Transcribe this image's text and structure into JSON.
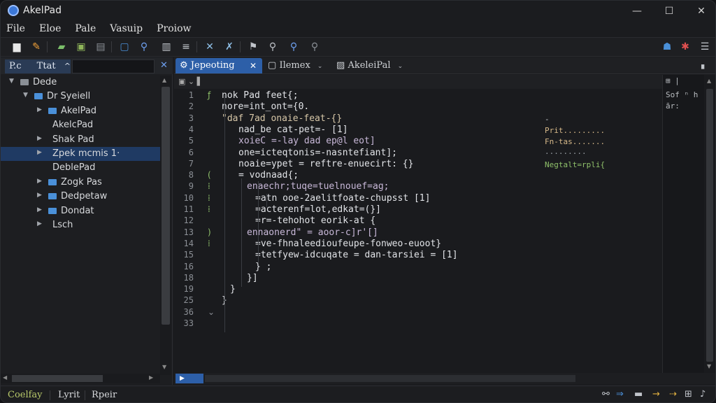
{
  "window": {
    "title": "AkelPad",
    "minimize": "—",
    "maximize": "☐",
    "close": "✕"
  },
  "menu": [
    "File",
    "Eloe",
    "Pale",
    "Vasuip",
    "Proiow"
  ],
  "toolbar": {
    "icons": [
      {
        "name": "new-file-icon",
        "glyph": "▆",
        "color": "#e8e8e8"
      },
      {
        "name": "edit-icon",
        "glyph": "✎",
        "color": "#f2a23a"
      },
      {
        "name": "open-icon",
        "glyph": "▰",
        "color": "#7bbf6a"
      },
      {
        "name": "save-icon",
        "glyph": "▣",
        "color": "#8fb55a"
      },
      {
        "name": "save-all-icon",
        "glyph": "▤",
        "color": "#8a8f96"
      },
      {
        "name": "view-icon",
        "glyph": "▢",
        "color": "#4a90d9"
      },
      {
        "name": "search-icon",
        "glyph": "⚲",
        "color": "#6ea0f0"
      },
      {
        "name": "panel-icon",
        "glyph": "▥",
        "color": "#c0c4ca"
      },
      {
        "name": "lines-icon",
        "glyph": "≡",
        "color": "#c0c4ca"
      },
      {
        "name": "tools-icon",
        "glyph": "✕",
        "color": "#8fc0e8"
      },
      {
        "name": "pin-icon",
        "glyph": "✗",
        "color": "#8fc0e8"
      },
      {
        "name": "flag-icon",
        "glyph": "⚑",
        "color": "#c0c4ca"
      },
      {
        "name": "zoom-icon",
        "glyph": "⚲",
        "color": "#c0c4ca"
      },
      {
        "name": "zoom-in-icon",
        "glyph": "⚲",
        "color": "#6ea0f0"
      },
      {
        "name": "zoom-out-icon",
        "glyph": "⚲",
        "color": "#8a8f96"
      }
    ],
    "right_icons": [
      {
        "name": "user-icon",
        "glyph": "☗",
        "color": "#4a90d9"
      },
      {
        "name": "gear-icon",
        "glyph": "✱",
        "color": "#e05050"
      },
      {
        "name": "list-icon",
        "glyph": "☰",
        "color": "#c0c4ca"
      }
    ]
  },
  "sidebar": {
    "tab_label": "P.c",
    "tab_text": "Ttat",
    "tab_chevron": "^",
    "close": "✕",
    "tree": [
      {
        "label": "Dede",
        "level": 0,
        "arrow": "▼",
        "folder": "gray"
      },
      {
        "label": "Dr Syeiell",
        "level": 1,
        "arrow": "▼",
        "folder": "blue"
      },
      {
        "label": "AkelPad",
        "level": 2,
        "arrow": "▶",
        "folder": "blue"
      },
      {
        "label": "AkelcPad",
        "level": 2,
        "arrow": "",
        "folder": "none"
      },
      {
        "label": "Shak Pad",
        "level": 2,
        "arrow": "▶",
        "folder": "none"
      },
      {
        "label": "Zpek mcmis 1·",
        "level": 2,
        "arrow": "▶",
        "folder": "none",
        "selected": true
      },
      {
        "label": "DeblePad",
        "level": 2,
        "arrow": "",
        "folder": "none"
      },
      {
        "label": "Zogk Pas",
        "level": 2,
        "arrow": "▶",
        "folder": "blue"
      },
      {
        "label": "Dedpetaw",
        "level": 2,
        "arrow": "▶",
        "folder": "blue"
      },
      {
        "label": "Dondat",
        "level": 2,
        "arrow": "▶",
        "folder": "blue"
      },
      {
        "label": "Lsch",
        "level": 2,
        "arrow": "▶",
        "folder": "none"
      }
    ]
  },
  "editor_tabs": [
    {
      "label": "Jepeoting",
      "icon": "⚙",
      "active": true,
      "close": "✕"
    },
    {
      "label": "Ilemex",
      "icon": "▢",
      "active": false,
      "chevron": "⌄"
    },
    {
      "label": "AkeleiPal",
      "icon": "▨",
      "active": false,
      "chevron": "⌄"
    }
  ],
  "editor": {
    "toolstrip": "▣ ⌄ ▌",
    "line_numbers": [
      "1",
      "2",
      "3",
      "4",
      "5",
      "6",
      "7",
      "8",
      "9",
      "10",
      "11",
      "12",
      "13",
      "14",
      "15",
      "16",
      "18",
      "19",
      "25",
      "36",
      "33"
    ],
    "lines": [
      {
        "indent": 0,
        "text": "nok Pad feet{;",
        "color": "#e2e4e8"
      },
      {
        "indent": 0,
        "text": "nore=int_ont={0.",
        "color": "#e2e4e8"
      },
      {
        "indent": 0,
        "text": "\"daf 7ad onaie-feat-{}",
        "color": "#d7c7a8"
      },
      {
        "indent": 2,
        "text": "nad_be cat-pet=- [1]",
        "color": "#e2e4e8"
      },
      {
        "indent": 2,
        "text": "xoieC =-lay dad ep@l eot]",
        "color": "#c8b8d8"
      },
      {
        "indent": 2,
        "text": "one=icteqtonis=-nasntefiant];",
        "color": "#e2e4e8"
      },
      {
        "indent": 2,
        "text": "noaie=ypet = reftre-enuecirt: {}",
        "color": "#e2e4e8"
      },
      {
        "indent": 2,
        "text": "= vodnaad{;",
        "color": "#e2e4e8"
      },
      {
        "indent": 3,
        "text": "enaechr;tuqe=tuelnouef=ag;",
        "color": "#c8b8d8"
      },
      {
        "indent": 4,
        "text": "=atn ooe-2aelitfoate-chupsst [1]",
        "color": "#e2e4e8"
      },
      {
        "indent": 4,
        "text": "=acterenf=lot,edkat=(}]",
        "color": "#e2e4e8"
      },
      {
        "indent": 4,
        "text": "=r=-tehohot eorik-at {",
        "color": "#e2e4e8"
      },
      {
        "indent": 3,
        "text": "ennaonerd\" = aoor-c]r'[]",
        "color": "#c8b8d8"
      },
      {
        "indent": 4,
        "text": "=ve-fhnaleedioufeupe-fonweo-euoot}",
        "color": "#e2e4e8"
      },
      {
        "indent": 4,
        "text": "=tetfyew-idcuqate = dan-tarsiei = [1]",
        "color": "#e2e4e8"
      },
      {
        "indent": 4,
        "text": "} ;",
        "color": "#e2e4e8"
      },
      {
        "indent": 3,
        "text": "}]",
        "color": "#e2e4e8"
      },
      {
        "indent": 1,
        "text": "}",
        "color": "#e2e4e8"
      },
      {
        "indent": 0,
        "text": "}",
        "color": "#e2e4e8"
      },
      {
        "indent": 0,
        "text": "",
        "color": "#e2e4e8"
      }
    ],
    "notes": [
      {
        "row": 2,
        "text": "-",
        "color": "#c0c4ca"
      },
      {
        "row": 3,
        "text": "Prit.........",
        "color": "#d7b98a"
      },
      {
        "row": 4,
        "text": "Fn-tas.......",
        "color": "#d7b98a"
      },
      {
        "row": 5,
        "text": "·········",
        "color": "#9aa0a6"
      },
      {
        "row": 6,
        "text": "Negtalt=rpli{",
        "color": "#8fc06a"
      }
    ],
    "minimap": [
      "Sof ⁿ h",
      "ār:",
      "",
      "",
      "",
      ""
    ],
    "minimap_top": "⊞ |"
  },
  "status": {
    "items": [
      "Coelfay",
      "Lyrit",
      "Rpeir"
    ],
    "right_icons": [
      {
        "name": "link-icon",
        "glyph": "⚯",
        "color": "#c0c4ca"
      },
      {
        "name": "encoding-icon",
        "glyph": "⇒",
        "color": "#4a90d9"
      },
      {
        "name": "flag-status-icon",
        "glyph": "▬",
        "color": "#c0c4ca"
      },
      {
        "name": "arrow-icon",
        "glyph": "→",
        "color": "#e0b040"
      },
      {
        "name": "forward-icon",
        "glyph": "⇢",
        "color": "#e0b040"
      },
      {
        "name": "grid-icon",
        "glyph": "⊞",
        "color": "#c0c4ca"
      },
      {
        "name": "bell-icon",
        "glyph": "♪",
        "color": "#c0c4ca"
      }
    ]
  }
}
